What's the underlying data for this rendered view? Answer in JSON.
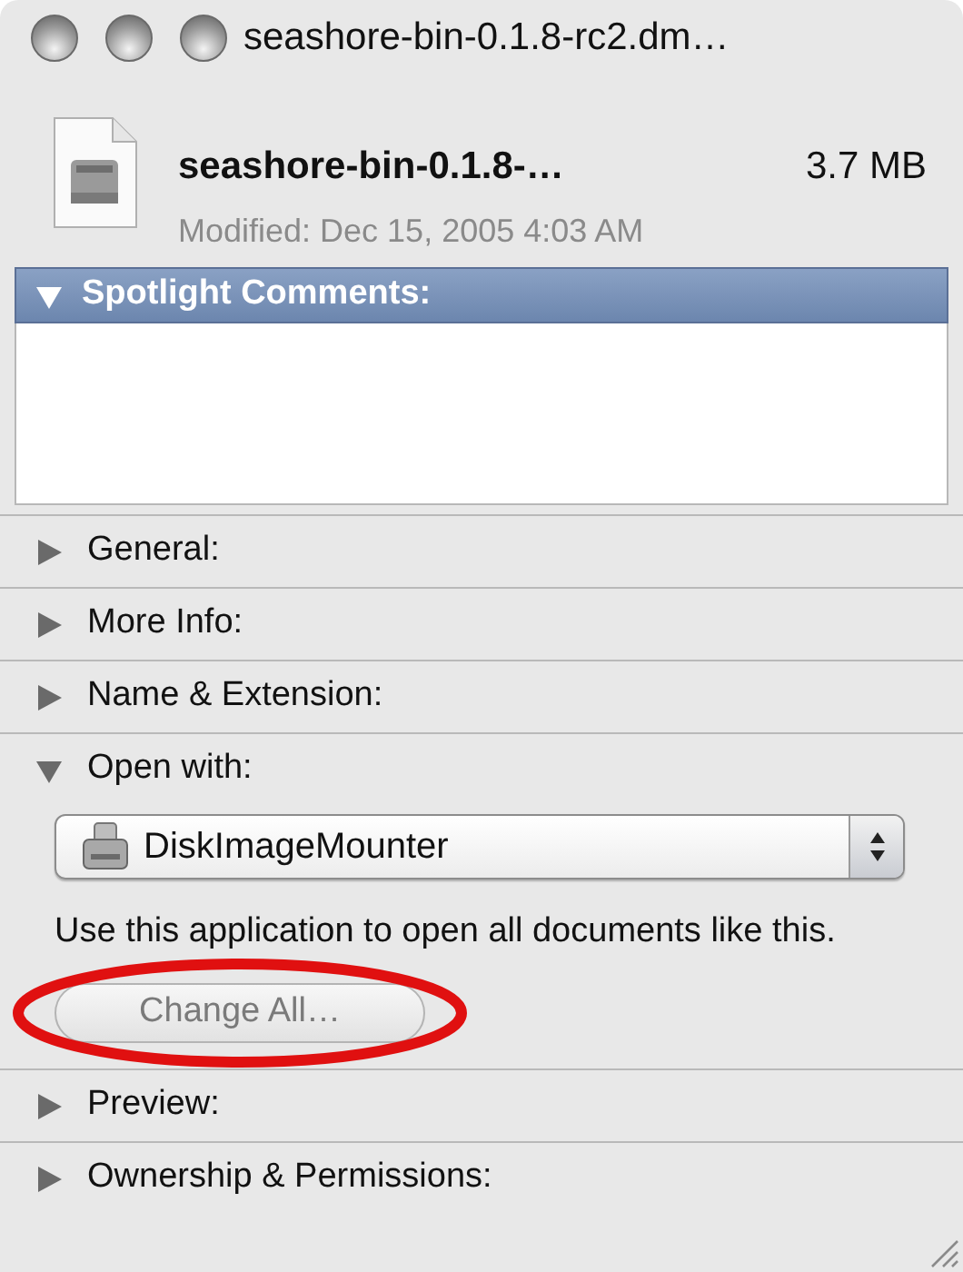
{
  "window": {
    "title": "seashore-bin-0.1.8-rc2.dm…"
  },
  "file": {
    "name": "seashore-bin-0.1.8-…",
    "size": "3.7 MB",
    "modified": "Modified: Dec 15, 2005 4:03 AM"
  },
  "spotlight": {
    "label": "Spotlight Comments:",
    "expanded": true,
    "selected": true
  },
  "sections": [
    {
      "label": "General:",
      "expanded": false
    },
    {
      "label": "More Info:",
      "expanded": false
    },
    {
      "label": "Name & Extension:",
      "expanded": false
    },
    {
      "label": "Open with:",
      "expanded": true,
      "popup": {
        "value": "DiskImageMounter"
      },
      "note": "Use this application to open all documents like this.",
      "button": {
        "label": "Change All…",
        "disabled": true
      }
    },
    {
      "label": "Preview:",
      "expanded": false
    },
    {
      "label": "Ownership & Permissions:",
      "expanded": false
    }
  ]
}
